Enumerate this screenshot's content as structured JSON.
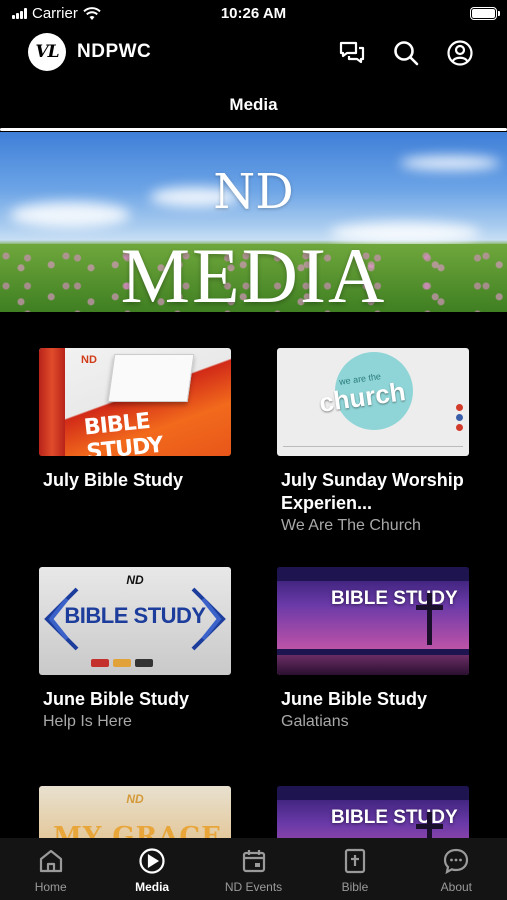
{
  "status_bar": {
    "carrier": "Carrier",
    "time": "10:26 AM"
  },
  "header": {
    "logo_text": "VL",
    "brand": "NDPWC"
  },
  "page_title": "Media",
  "banner": {
    "line1": "ND",
    "line2": "MEDIA"
  },
  "media_items": [
    {
      "title": "July Bible Study",
      "subtitle": "",
      "thumb_text": "BIBLE STUDY",
      "thumb_tag": "ND"
    },
    {
      "title": "July Sunday Worship Experien...",
      "subtitle": "We Are The Church",
      "thumb_text": "church",
      "thumb_tag": "we are the"
    },
    {
      "title": "June Bible Study",
      "subtitle": "Help Is Here",
      "thumb_text": "BIBLE STUDY",
      "thumb_tag": "ND"
    },
    {
      "title": "June Bible Study",
      "subtitle": "Galatians",
      "thumb_text": "BIBLE STUDY",
      "thumb_tag": ""
    },
    {
      "title": "",
      "subtitle": "",
      "thumb_text": "MY GRACE",
      "thumb_tag": "ND"
    },
    {
      "title": "",
      "subtitle": "",
      "thumb_text": "BIBLE STUDY",
      "thumb_tag": ""
    }
  ],
  "tabs": [
    {
      "label": "Home",
      "icon": "home-icon"
    },
    {
      "label": "Media",
      "icon": "play-icon"
    },
    {
      "label": "ND Events",
      "icon": "calendar-icon"
    },
    {
      "label": "Bible",
      "icon": "bible-icon"
    },
    {
      "label": "About",
      "icon": "chat-bubble-icon"
    }
  ],
  "colors": {
    "background": "#000000",
    "tab_bar": "#141414",
    "inactive_tab": "#9a9a9a",
    "subtitle": "#a8a8a8"
  }
}
